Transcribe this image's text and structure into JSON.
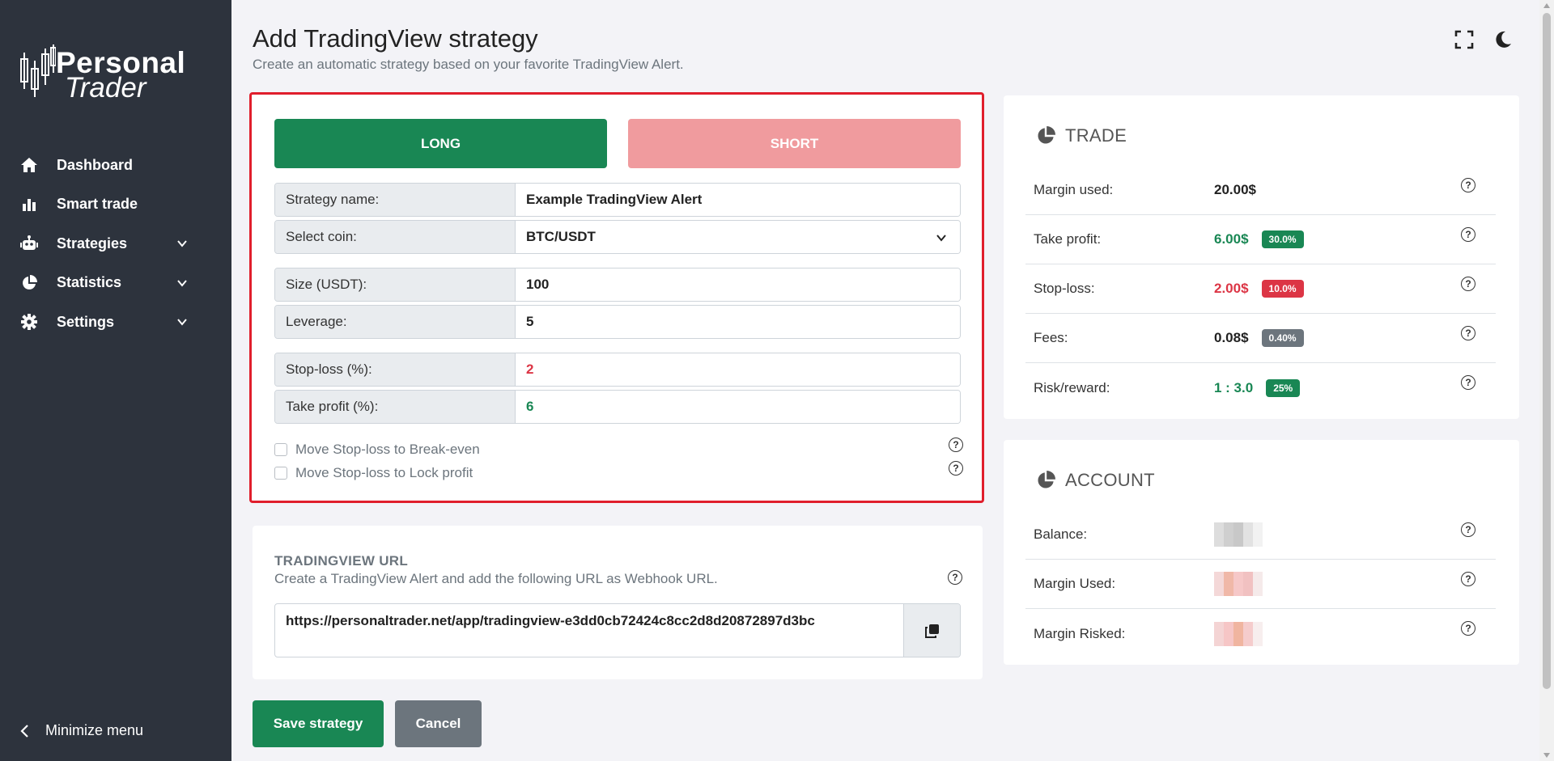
{
  "brand": {
    "line1": "Personal",
    "line2": "Trader"
  },
  "sidebar": {
    "items": [
      {
        "label": "Dashboard",
        "icon": "home-icon"
      },
      {
        "label": "Smart trade",
        "icon": "bar-chart-icon"
      },
      {
        "label": "Strategies",
        "icon": "robot-icon"
      },
      {
        "label": "Statistics",
        "icon": "pie-chart-icon"
      },
      {
        "label": "Settings",
        "icon": "gear-icon"
      }
    ],
    "minimize_label": "Minimize menu"
  },
  "header": {
    "title": "Add TradingView strategy",
    "subtitle": "Create an automatic strategy based on your favorite TradingView Alert."
  },
  "form": {
    "long_label": "LONG",
    "short_label": "SHORT",
    "fields": {
      "strategy_name": {
        "label": "Strategy name:",
        "value": "Example TradingView Alert"
      },
      "coin": {
        "label": "Select coin:",
        "value": "BTC/USDT"
      },
      "size": {
        "label": "Size (USDT):",
        "value": "100"
      },
      "leverage": {
        "label": "Leverage:",
        "value": "5"
      },
      "stop_loss": {
        "label": "Stop-loss (%):",
        "value": "2"
      },
      "take_profit": {
        "label": "Take profit (%):",
        "value": "6"
      }
    },
    "checkboxes": {
      "break_even": "Move Stop-loss to Break-even",
      "lock_profit": "Move Stop-loss to Lock profit"
    }
  },
  "tradingview": {
    "title": "TRADINGVIEW URL",
    "subtitle": "Create a TradingView Alert and add the following URL as Webhook URL.",
    "url": "https://personaltrader.net/app/tradingview-e3dd0cb72424c8cc2d8d20872897d3bc"
  },
  "actions": {
    "save": "Save strategy",
    "cancel": "Cancel"
  },
  "trade": {
    "title": "TRADE",
    "margin_used": {
      "label": "Margin used:",
      "value": "20.00$"
    },
    "take_profit": {
      "label": "Take profit:",
      "value": "6.00$",
      "badge": "30.0%"
    },
    "stop_loss": {
      "label": "Stop-loss:",
      "value": "2.00$",
      "badge": "10.0%"
    },
    "fees": {
      "label": "Fees:",
      "value": "0.08$",
      "badge": "0.40%"
    },
    "risk_reward": {
      "label": "Risk/reward:",
      "value": "1 : 3.0",
      "badge": "25%"
    }
  },
  "account": {
    "title": "ACCOUNT",
    "balance": {
      "label": "Balance:"
    },
    "margin_used": {
      "label": "Margin Used:"
    },
    "margin_risked": {
      "label": "Margin Risked:"
    }
  },
  "help_glyph": "?",
  "colors": {
    "green": "#198754",
    "red": "#dc3545",
    "sidebar": "#2d333d",
    "highlight_border": "#e01e2c"
  }
}
